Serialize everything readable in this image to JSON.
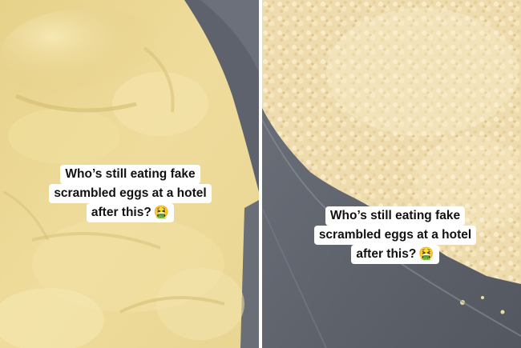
{
  "panels": [
    {
      "caption": {
        "line1": "Who’s still eating fake",
        "line2": "scrambled eggs at a hotel",
        "line3": "after this?",
        "emoji": "🤮"
      }
    },
    {
      "caption": {
        "line1": "Who’s still eating fake",
        "line2": "scrambled eggs at a hotel",
        "line3": "after this?",
        "emoji": "🤮"
      }
    }
  ],
  "colors": {
    "egg_left": "#ecd68f",
    "egg_right": "#f1ddb0",
    "tray": "#5f6470",
    "caption_bg": "#ffffff",
    "caption_text": "#111111"
  }
}
